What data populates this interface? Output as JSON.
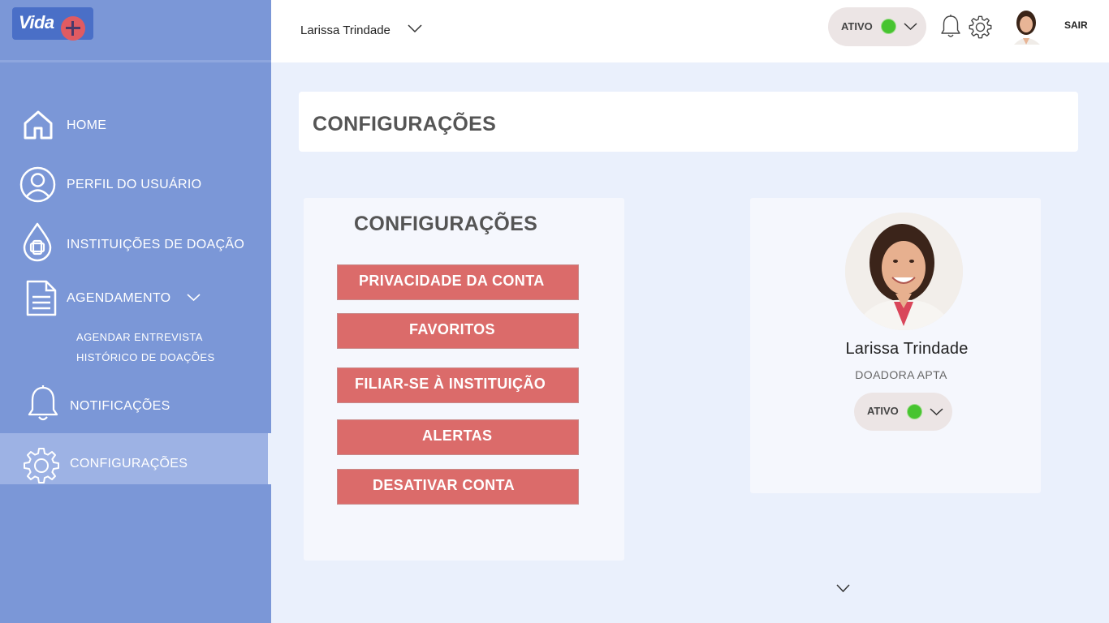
{
  "app": {
    "logo_text": "Vida",
    "colors": {
      "sidebar": "#7b97d7",
      "accent": "#db6b6a",
      "status_green": "#47c430"
    }
  },
  "topbar": {
    "user_name": "Larissa Trindade",
    "status_label": "ATIVO",
    "logout_label": "SAIR",
    "icons": [
      "bell-icon",
      "gear-icon",
      "chevron-down-icon"
    ]
  },
  "sidebar": {
    "items": [
      {
        "label": "HOME",
        "icon": "home-icon"
      },
      {
        "label": "PERFIL DO USUÁRIO",
        "icon": "user-icon"
      },
      {
        "label": "INSTITUIÇÕES DE DOAÇÃO",
        "icon": "blood-drop-icon"
      },
      {
        "label": "AGENDAMENTO",
        "icon": "document-icon"
      },
      {
        "label": "NOTIFICAÇÕES",
        "icon": "bell-icon"
      },
      {
        "label": "CONFIGURAÇÕES",
        "icon": "gear-icon",
        "active": true
      }
    ],
    "sub_items": [
      "AGENDAR ENTREVISTA",
      "HISTÓRICO DE DOAÇÕES"
    ]
  },
  "main": {
    "page_title": "CONFIGURAÇÕES",
    "settings": {
      "title": "CONFIGURAÇÕES",
      "buttons": [
        "PRIVACIDADE DA CONTA",
        "FAVORITOS",
        "FILIAR-SE À INSTITUIÇÃO",
        "ALERTAS",
        "DESATIVAR CONTA"
      ]
    },
    "profile": {
      "name": "Larissa Trindade",
      "role": "DOADORA APTA",
      "status_label": "ATIVO"
    }
  }
}
